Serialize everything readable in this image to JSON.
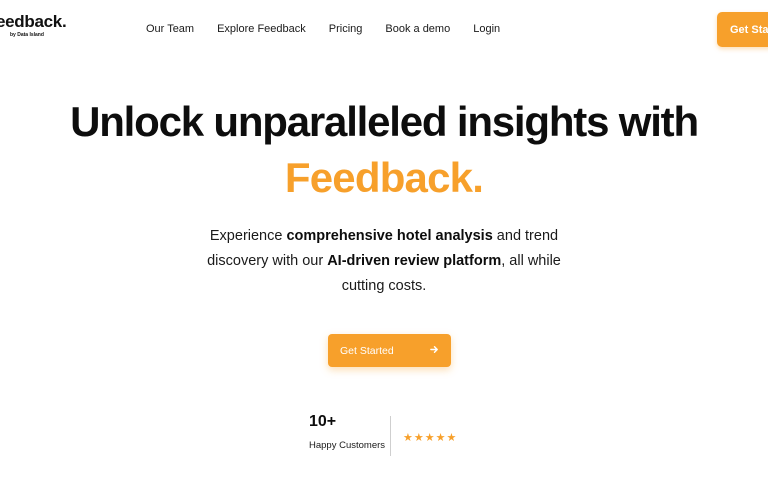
{
  "brand": {
    "name": "eedback.",
    "tagline": "by Data Island",
    "accent_color": "#f7a02b"
  },
  "nav": {
    "items": [
      {
        "label": "Our Team"
      },
      {
        "label": "Explore Feedback"
      },
      {
        "label": "Pricing"
      },
      {
        "label": "Book a demo"
      },
      {
        "label": "Login"
      }
    ],
    "cta_label": "Get Started"
  },
  "hero": {
    "title": "Unlock unparalleled insights with",
    "title_accent": "Feedback.",
    "subtitle": {
      "part1": "Experience ",
      "bold1": "comprehensive hotel analysis",
      "part2": " and trend discovery with our ",
      "bold2": "AI-driven review platform",
      "part3": ", all while cutting costs."
    },
    "cta_label": "Get Started",
    "cta_icon": "arrow-right-icon"
  },
  "stats": {
    "count": "10+",
    "label": "Happy Customers",
    "stars": "★★★★★",
    "rating": 5
  }
}
